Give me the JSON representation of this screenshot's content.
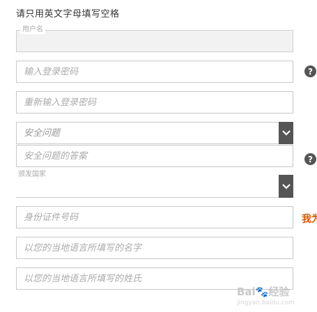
{
  "instruction": "请只用英文字母填写空格",
  "username": {
    "label": "用户名",
    "value": ""
  },
  "password": {
    "placeholder": "输入登录密码"
  },
  "confirm_password": {
    "placeholder": "重新输入登录密码"
  },
  "security_question": {
    "selected": "安全问题"
  },
  "security_answer": {
    "placeholder": "安全问题的答案"
  },
  "country": {
    "label": "颁发国家",
    "selected": ""
  },
  "id_number": {
    "placeholder": "身份证件号码"
  },
  "first_name": {
    "placeholder": "以您的当地语言所填写的名字"
  },
  "last_name": {
    "placeholder": "以您的当地语言所填写的姓氏"
  },
  "help_symbol": "?",
  "side_link": "我为",
  "watermark": {
    "logo": "Bai🐾经验",
    "sub": "jingyan.baidu.com"
  },
  "colors": {
    "accent": "#e05500",
    "select_button": "#555555",
    "border": "#c8c8c8"
  }
}
